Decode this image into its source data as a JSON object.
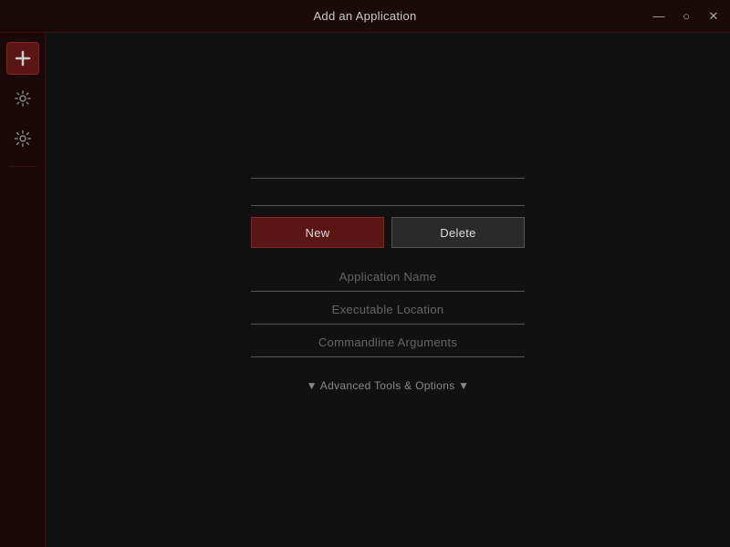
{
  "window": {
    "title": "Add an Application",
    "controls": {
      "minimize": "—",
      "maximize": "○",
      "close": "✕"
    }
  },
  "sidebar": {
    "buttons": [
      {
        "id": "add",
        "icon": "plus",
        "active": true
      },
      {
        "id": "settings1",
        "icon": "gear"
      },
      {
        "id": "settings2",
        "icon": "gear-detail"
      }
    ]
  },
  "form": {
    "new_button": "New",
    "delete_button": "Delete",
    "application_name_placeholder": "Application Name",
    "executable_location_placeholder": "Executable Location",
    "commandline_arguments_placeholder": "Commandline Arguments",
    "advanced_tools_label": "▼ Advanced Tools & Options ▼"
  }
}
